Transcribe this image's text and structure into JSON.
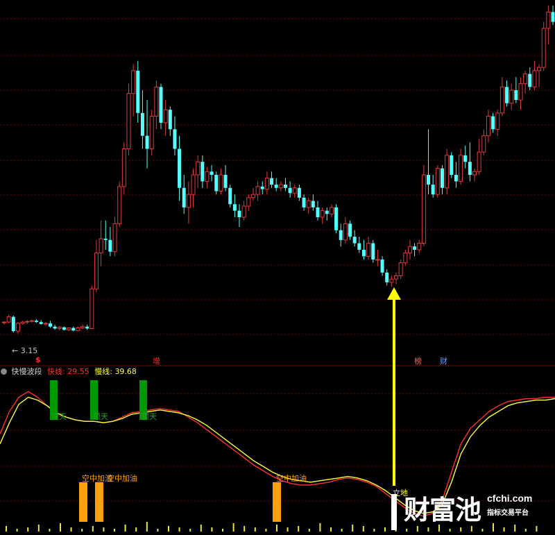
{
  "colors": {
    "background": "#000000",
    "up": "#e03c3c",
    "down": "#54ffff",
    "grid": "#7a0000",
    "fast_line": "#ff3030",
    "slow_line": "#ffff40",
    "bar_green": "#009a00",
    "bar_orange": "#ffa010",
    "arrow_yellow": "#ffff00",
    "volume_yellow": "#e8e83a",
    "marker_red": "#ff3030",
    "marker_blue": "#6ea0ff"
  },
  "price_panel": {
    "low_label": "3.15",
    "markers": [
      {
        "text": "$",
        "color": "#ff3030"
      },
      {
        "text": "增",
        "color": "#ff3030"
      },
      {
        "text": "榜",
        "color": "#ff6060"
      },
      {
        "text": "财",
        "color": "#6ea0ff"
      }
    ]
  },
  "indicator_panel": {
    "title": "快慢波段",
    "fast_label": "快线:",
    "fast_value": "29.55",
    "slow_label": "慢线:",
    "slow_value": "39.68",
    "green_bar_labels": [
      "顶天",
      "顶天",
      "顶天"
    ],
    "orange_bar_labels": [
      "空中加油",
      "空中加油",
      "空中加油"
    ],
    "bottom_label": "立地"
  },
  "watermark": {
    "brand": "财富池",
    "domain": "cfchi.com",
    "slogan": "指标交易平台"
  },
  "chart_data": [
    {
      "type": "candlestick",
      "title": "",
      "ylim": [
        3.0,
        8.2
      ],
      "annotation_min": 3.15,
      "grid": true,
      "candles": [
        [
          3.33,
          3.35,
          3.3,
          3.34
        ],
        [
          3.34,
          3.45,
          3.32,
          3.42
        ],
        [
          3.42,
          3.44,
          3.18,
          3.2
        ],
        [
          3.2,
          3.34,
          3.16,
          3.32
        ],
        [
          3.32,
          3.36,
          3.3,
          3.34
        ],
        [
          3.34,
          3.37,
          3.31,
          3.35
        ],
        [
          3.35,
          3.38,
          3.33,
          3.36
        ],
        [
          3.36,
          3.38,
          3.33,
          3.34
        ],
        [
          3.34,
          3.37,
          3.3,
          3.31
        ],
        [
          3.31,
          3.34,
          3.28,
          3.32
        ],
        [
          3.32,
          3.36,
          3.25,
          3.27
        ],
        [
          3.27,
          3.3,
          3.22,
          3.24
        ],
        [
          3.24,
          3.28,
          3.21,
          3.26
        ],
        [
          3.26,
          3.27,
          3.21,
          3.22
        ],
        [
          3.22,
          3.26,
          3.2,
          3.25
        ],
        [
          3.25,
          3.27,
          3.2,
          3.21
        ],
        [
          3.21,
          3.27,
          3.2,
          3.25
        ],
        [
          3.25,
          3.3,
          3.23,
          3.27
        ],
        [
          3.27,
          3.3,
          3.22,
          3.24
        ],
        [
          3.24,
          3.9,
          3.23,
          3.85
        ],
        [
          3.85,
          4.6,
          3.8,
          4.4
        ],
        [
          4.4,
          4.9,
          4.2,
          4.62
        ],
        [
          4.62,
          4.9,
          4.45,
          4.6
        ],
        [
          4.6,
          4.8,
          4.35,
          4.42
        ],
        [
          4.42,
          4.95,
          4.35,
          4.85
        ],
        [
          4.85,
          5.5,
          4.8,
          5.42
        ],
        [
          5.42,
          6.1,
          5.3,
          6.0
        ],
        [
          6.0,
          7.0,
          5.9,
          6.85
        ],
        [
          6.85,
          7.3,
          6.5,
          7.2
        ],
        [
          7.2,
          7.35,
          6.4,
          6.55
        ],
        [
          6.55,
          6.9,
          6.0,
          6.2
        ],
        [
          6.2,
          6.75,
          5.7,
          6.0
        ],
        [
          6.0,
          6.6,
          5.9,
          6.5
        ],
        [
          6.5,
          7.05,
          6.3,
          6.95
        ],
        [
          6.95,
          7.0,
          6.3,
          6.4
        ],
        [
          6.4,
          6.75,
          6.2,
          6.6
        ],
        [
          6.6,
          6.65,
          6.2,
          6.3
        ],
        [
          6.3,
          6.5,
          5.9,
          6.0
        ],
        [
          6.0,
          6.2,
          5.2,
          5.4
        ],
        [
          5.4,
          5.6,
          5.0,
          5.1
        ],
        [
          5.1,
          5.5,
          4.85,
          5.3
        ],
        [
          5.3,
          5.7,
          5.1,
          5.6
        ],
        [
          5.6,
          5.9,
          5.4,
          5.8
        ],
        [
          5.8,
          5.9,
          5.4,
          5.5
        ],
        [
          5.5,
          5.72,
          5.4,
          5.65
        ],
        [
          5.65,
          5.75,
          5.5,
          5.6
        ],
        [
          5.6,
          5.65,
          5.3,
          5.35
        ],
        [
          5.35,
          5.7,
          5.3,
          5.6
        ],
        [
          5.6,
          5.75,
          5.35,
          5.4
        ],
        [
          5.4,
          5.45,
          5.1,
          5.15
        ],
        [
          5.15,
          5.3,
          4.95,
          5.05
        ],
        [
          5.05,
          5.15,
          4.8,
          4.95
        ],
        [
          4.95,
          5.2,
          4.9,
          5.12
        ],
        [
          5.12,
          5.3,
          5.05,
          5.25
        ],
        [
          5.25,
          5.4,
          5.2,
          5.3
        ],
        [
          5.3,
          5.5,
          5.2,
          5.42
        ],
        [
          5.42,
          5.5,
          5.3,
          5.38
        ],
        [
          5.38,
          5.65,
          5.3,
          5.55
        ],
        [
          5.55,
          5.65,
          5.4,
          5.45
        ],
        [
          5.45,
          5.55,
          5.35,
          5.4
        ],
        [
          5.4,
          5.5,
          5.35,
          5.45
        ],
        [
          5.45,
          5.55,
          5.35,
          5.4
        ],
        [
          5.4,
          5.5,
          5.25,
          5.32
        ],
        [
          5.32,
          5.45,
          5.25,
          5.4
        ],
        [
          5.4,
          5.45,
          5.2,
          5.25
        ],
        [
          5.25,
          5.3,
          5.05,
          5.1
        ],
        [
          5.1,
          5.25,
          5.0,
          5.2
        ],
        [
          5.2,
          5.3,
          5.05,
          5.1
        ],
        [
          5.1,
          5.2,
          4.9,
          4.95
        ],
        [
          4.95,
          5.1,
          4.85,
          5.05
        ],
        [
          5.05,
          5.1,
          4.9,
          5.0
        ],
        [
          5.0,
          5.15,
          4.95,
          5.1
        ],
        [
          5.1,
          5.15,
          4.7,
          4.75
        ],
        [
          4.75,
          4.85,
          4.5,
          4.6
        ],
        [
          4.6,
          4.95,
          4.55,
          4.85
        ],
        [
          4.85,
          4.9,
          4.6,
          4.65
        ],
        [
          4.65,
          4.75,
          4.5,
          4.55
        ],
        [
          4.55,
          4.65,
          4.4,
          4.45
        ],
        [
          4.45,
          4.6,
          4.3,
          4.35
        ],
        [
          4.35,
          4.65,
          4.3,
          4.55
        ],
        [
          4.55,
          4.6,
          4.25,
          4.3
        ],
        [
          4.3,
          4.45,
          4.2,
          4.3
        ],
        [
          4.3,
          4.35,
          4.05,
          4.1
        ],
        [
          4.1,
          4.15,
          3.9,
          3.95
        ],
        [
          3.95,
          4.05,
          3.88,
          4.0
        ],
        [
          4.0,
          4.1,
          3.92,
          4.05
        ],
        [
          4.05,
          4.3,
          4.0,
          4.25
        ],
        [
          4.25,
          4.45,
          4.2,
          4.4
        ],
        [
          4.4,
          4.6,
          4.3,
          4.5
        ],
        [
          4.5,
          4.55,
          4.35,
          4.45
        ],
        [
          4.45,
          4.6,
          4.4,
          4.55
        ],
        [
          4.55,
          5.75,
          4.5,
          5.6
        ],
        [
          5.6,
          6.3,
          5.3,
          5.45
        ],
        [
          5.45,
          5.6,
          5.25,
          5.3
        ],
        [
          5.3,
          5.75,
          5.25,
          5.7
        ],
        [
          5.7,
          5.75,
          5.3,
          5.4
        ],
        [
          5.4,
          6.0,
          5.3,
          5.9
        ],
        [
          5.9,
          5.95,
          5.55,
          5.6
        ],
        [
          5.6,
          5.8,
          5.4,
          5.5
        ],
        [
          5.5,
          6.0,
          5.45,
          5.9
        ],
        [
          5.9,
          6.05,
          5.7,
          5.8
        ],
        [
          5.8,
          6.1,
          5.5,
          5.6
        ],
        [
          5.6,
          5.7,
          5.5,
          5.65
        ],
        [
          5.65,
          6.15,
          5.6,
          5.95
        ],
        [
          5.95,
          6.3,
          5.9,
          6.2
        ],
        [
          6.2,
          6.6,
          6.1,
          6.5
        ],
        [
          6.5,
          6.55,
          6.25,
          6.3
        ],
        [
          6.3,
          6.6,
          6.2,
          6.55
        ],
        [
          6.55,
          7.1,
          6.5,
          6.95
        ],
        [
          6.95,
          7.05,
          6.65,
          6.7
        ],
        [
          6.7,
          7.0,
          6.6,
          6.9
        ],
        [
          6.9,
          7.1,
          6.7,
          6.75
        ],
        [
          6.75,
          7.1,
          6.6,
          7.0
        ],
        [
          7.0,
          7.2,
          6.85,
          7.15
        ],
        [
          7.15,
          7.25,
          6.9,
          6.95
        ],
        [
          6.95,
          7.35,
          6.9,
          7.2
        ],
        [
          7.2,
          7.3,
          6.95,
          7.25
        ],
        [
          7.25,
          7.95,
          7.2,
          7.85
        ],
        [
          7.85,
          8.2,
          7.6,
          8.1
        ],
        [
          8.1,
          8.2,
          7.9,
          7.95
        ]
      ]
    },
    {
      "type": "line",
      "title": "快慢波段",
      "ylim": [
        0,
        100
      ],
      "grid": true,
      "series": [
        {
          "name": "快线",
          "color": "#ff3030",
          "values": [
            62,
            78,
            88,
            92,
            88,
            82,
            77,
            74,
            72,
            71,
            71,
            70,
            71,
            74,
            77,
            78,
            79,
            80,
            79,
            78,
            74,
            70,
            65,
            60,
            55,
            50,
            45,
            40,
            36,
            32,
            29,
            27,
            26,
            26,
            27,
            28,
            30,
            31,
            30,
            28,
            25,
            20,
            15,
            10,
            6,
            4,
            6,
            15,
            35,
            55,
            66,
            72,
            78,
            82,
            85,
            86,
            87,
            87,
            88,
            88
          ]
        },
        {
          "name": "慢线",
          "color": "#ffff40",
          "values": [
            55,
            70,
            83,
            88,
            86,
            82,
            77,
            74,
            72,
            71,
            71,
            70,
            71,
            73,
            76,
            77,
            78,
            79,
            78,
            77,
            75,
            72,
            68,
            63,
            58,
            53,
            48,
            43,
            39,
            35,
            32,
            30,
            29,
            28,
            29,
            30,
            31,
            32,
            31,
            29,
            26,
            22,
            17,
            12,
            8,
            6,
            7,
            12,
            28,
            48,
            60,
            68,
            74,
            78,
            82,
            84,
            85,
            86,
            86,
            87
          ]
        }
      ],
      "green_bars": [
        {
          "index": 0,
          "range": [
            72,
            100
          ]
        },
        {
          "index": 1,
          "range": [
            72,
            100
          ]
        },
        {
          "index": 2,
          "range": [
            72,
            100
          ]
        }
      ],
      "orange_bars": [
        {
          "index": 0,
          "range": [
            0,
            28
          ]
        },
        {
          "index": 1,
          "range": [
            0,
            28
          ]
        },
        {
          "index": 2,
          "range": [
            0,
            28
          ]
        }
      ],
      "volume_ticks": [
        4,
        2,
        3,
        5,
        2,
        6,
        3,
        2,
        4,
        3,
        2,
        5,
        3,
        7,
        2,
        4,
        3,
        2,
        5,
        3,
        2,
        6,
        4,
        3,
        2,
        5,
        3,
        4,
        2,
        6,
        3,
        2,
        5,
        4,
        2,
        3,
        6,
        2,
        4,
        3,
        5,
        2,
        3,
        4,
        2,
        6,
        3,
        5,
        2,
        4
      ]
    }
  ]
}
